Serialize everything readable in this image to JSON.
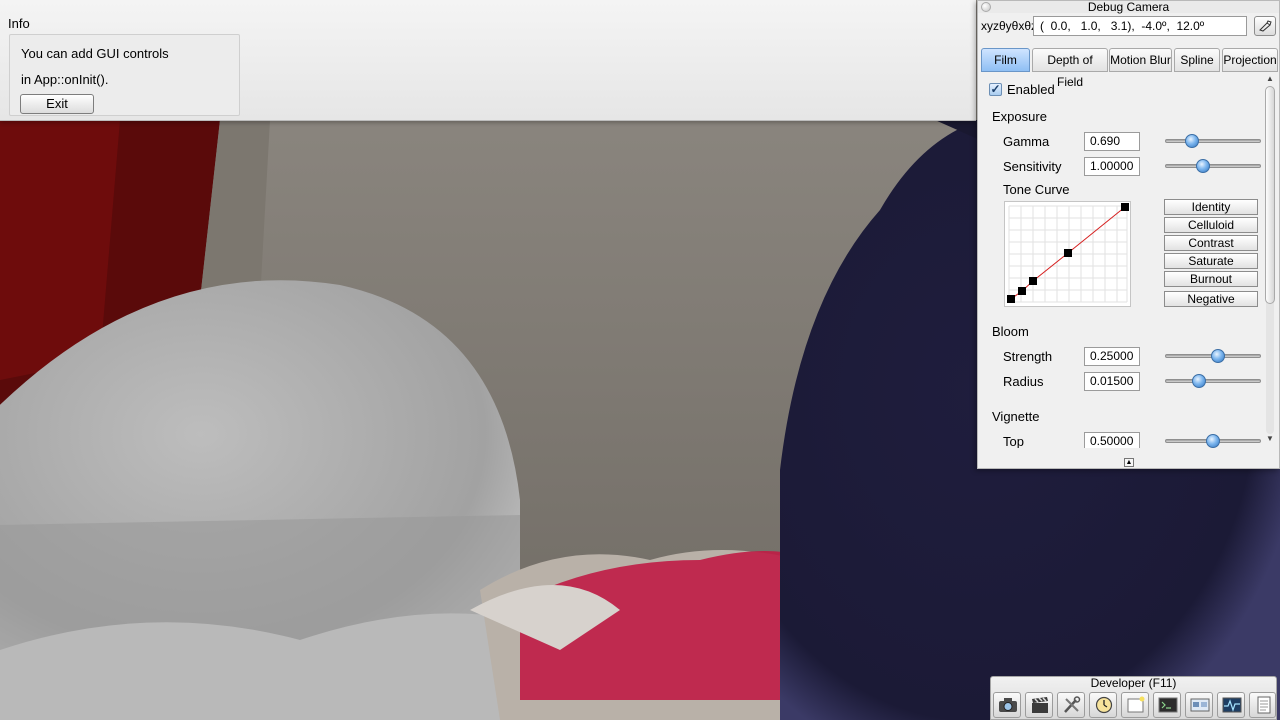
{
  "info": {
    "title": "Info",
    "line1": "You can add GUI controls",
    "line2": "in App::onInit().",
    "exit_label": "Exit"
  },
  "camera": {
    "title": "Debug Camera",
    "coord_label": "xyzθyθxθz",
    "coord_value": "(  0.0,   1.0,   3.1),  -4.0º,  12.0º",
    "tabs": [
      {
        "label": "Film",
        "active": true
      },
      {
        "label": "Depth of Field",
        "active": false
      },
      {
        "label": "Motion Blur",
        "active": false
      },
      {
        "label": "Spline",
        "active": false
      },
      {
        "label": "Projection",
        "active": false
      }
    ],
    "film": {
      "enabled_label": "Enabled",
      "enabled": true,
      "exposure_heading": "Exposure",
      "gamma_label": "Gamma",
      "gamma_value": "0.690",
      "gamma_level": 0.24,
      "sensitivity_label": "Sensitivity",
      "sensitivity_value": "1.00000",
      "sensitivity_level": 0.38,
      "tone_curve_label": "Tone Curve",
      "presets": [
        "Identity",
        "Celluloid",
        "Contrast",
        "Saturate",
        "Burnout",
        "Negative"
      ],
      "bloom_heading": "Bloom",
      "strength_label": "Strength",
      "strength_value": "0.25000",
      "strength_level": 0.56,
      "radius_label": "Radius",
      "radius_value": "0.01500",
      "radius_level": 0.33,
      "vignette_heading": "Vignette",
      "top_label": "Top",
      "top_value": "0.50000",
      "top_level": 0.5
    }
  },
  "developer": {
    "title": "Developer (F11)",
    "icons": [
      "camera-icon",
      "clapperboard-icon",
      "tools-icon",
      "clock-icon",
      "note-icon",
      "terminal-icon",
      "scene-window-icon",
      "profiler-icon",
      "log-icon"
    ]
  },
  "colors": {
    "tab_active": "#8fbff4",
    "curve_line": "#d62020",
    "sphere_dark": "#1f1d3d"
  }
}
